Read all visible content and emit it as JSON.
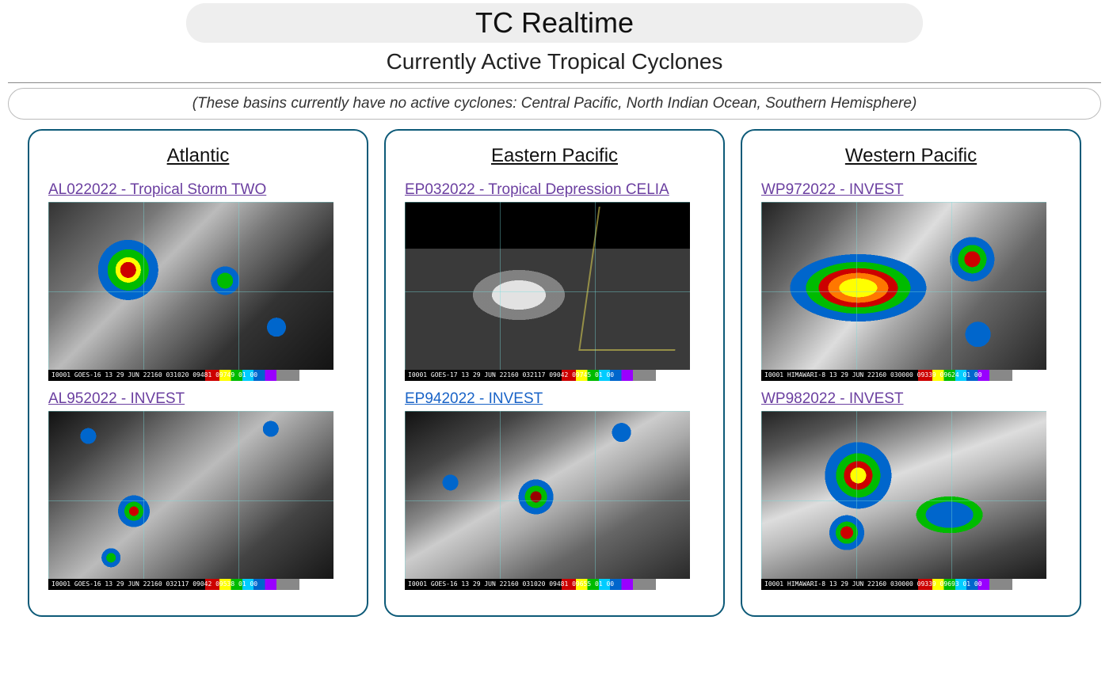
{
  "page": {
    "title": "TC Realtime",
    "subtitle": "Currently Active Tropical Cyclones",
    "inactive_note": "(These basins currently have no active cyclones: Central Pacific, North Indian Ocean, Southern Hemisphere)"
  },
  "basins": [
    {
      "name": "Atlantic",
      "storms": [
        {
          "id": "AL022022",
          "label": "AL022022 - Tropical Storm TWO",
          "link_state": "visited",
          "img_class": "sat-ir-active",
          "stamp": "I0001 GOES-16   13 29 JUN 22160 031020 09481 09749 01 00"
        },
        {
          "id": "AL952022",
          "label": "AL952022 - INVEST",
          "link_state": "visited",
          "img_class": "sat-ir-scattered",
          "stamp": "I0001 GOES-16   13 29 JUN 22160 032117 09042 09538 01 00"
        }
      ]
    },
    {
      "name": "Eastern Pacific",
      "storms": [
        {
          "id": "EP032022",
          "label": "EP032022 - Tropical Depression CELIA",
          "link_state": "visited",
          "img_class": "sat-vis-quiet",
          "stamp": "I0001 GOES-17   13 29 JUN 22160 032117 09042 09745 01 00"
        },
        {
          "id": "EP942022",
          "label": "EP942022 - INVEST",
          "link_state": "unvisited",
          "img_class": "sat-ir-center",
          "stamp": "I0001 GOES-16   13 29 JUN 22160 031020 09481 09655 01 00"
        }
      ]
    },
    {
      "name": "Western Pacific",
      "storms": [
        {
          "id": "WP972022",
          "label": "WP972022 - INVEST",
          "link_state": "visited",
          "img_class": "sat-ir-intense",
          "stamp": "I0001 HIMAWARI-8 13 29 JUN 22160 030000 09339 09624 01 00"
        },
        {
          "id": "WP982022",
          "label": "WP982022 - INVEST",
          "link_state": "visited",
          "img_class": "sat-ir-broad",
          "stamp": "I0001 HIMAWARI-8 13 29 JUN 22160 030000 09339 09693 01 00"
        }
      ]
    }
  ]
}
